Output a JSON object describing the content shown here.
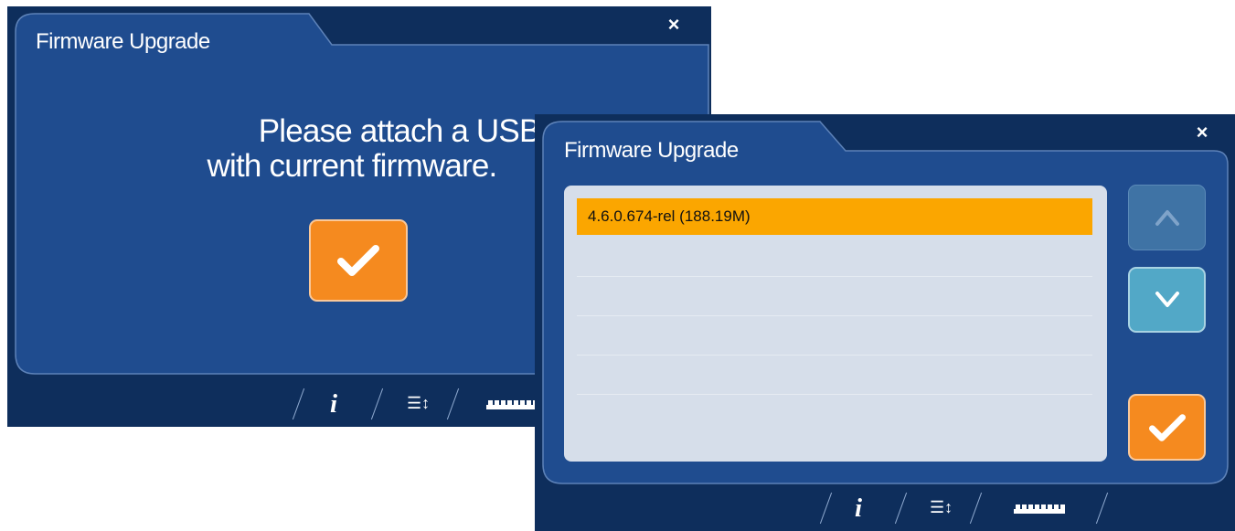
{
  "colors": {
    "frame": "#0e2e5c",
    "panel": "#1f4c8f",
    "panel_border": "#5d82b8",
    "accent_orange": "#f58a1f",
    "selected_row": "#fba600",
    "list_bg": "#d6deea",
    "scroll_up_disabled": "#3f73a5",
    "scroll_down": "#52a8c7"
  },
  "dialog_usb_prompt": {
    "title": "Firmware Upgrade",
    "close_icon": "×",
    "message_line1": "Please attach a USB drive",
    "message_line2": "with current firmware.",
    "confirm_icon": "checkmark-icon",
    "toolbar": {
      "info_icon": "i",
      "sort_icon": "☰↕",
      "ruler_icon": "ruler-icon"
    }
  },
  "dialog_firmware_list": {
    "title": "Firmware Upgrade",
    "close_icon": "×",
    "items": [
      {
        "label": "4.6.0.674-rel (188.19M)",
        "selected": true
      }
    ],
    "scroll_up_icon": "chevron-up-icon",
    "scroll_down_icon": "chevron-down-icon",
    "confirm_icon": "checkmark-icon",
    "toolbar": {
      "info_icon": "i",
      "sort_icon": "☰↕",
      "ruler_icon": "ruler-icon"
    }
  }
}
